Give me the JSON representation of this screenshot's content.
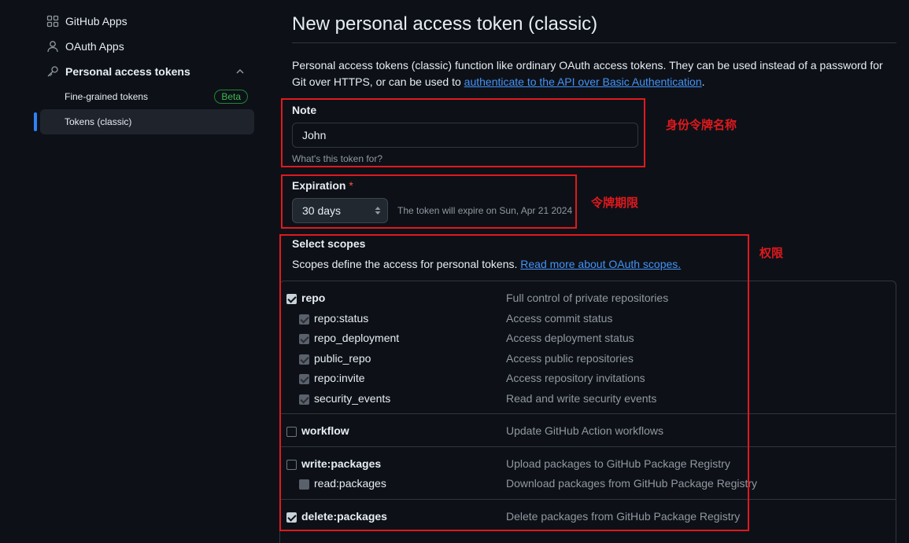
{
  "sidebar": {
    "items": [
      {
        "label": "GitHub Apps",
        "icon": "grid-icon"
      },
      {
        "label": "OAuth Apps",
        "icon": "person-icon"
      },
      {
        "label": "Personal access tokens",
        "icon": "key-icon"
      }
    ],
    "sub_items": [
      {
        "label": "Fine-grained tokens",
        "badge": "Beta"
      },
      {
        "label": "Tokens (classic)"
      }
    ]
  },
  "main": {
    "title": "New personal access token (classic)",
    "intro_text": "Personal access tokens (classic) function like ordinary OAuth access tokens. They can be used instead of a password for Git over HTTPS, or can be used to ",
    "intro_link": "authenticate to the API over Basic Authentication",
    "intro_end": ".",
    "note": {
      "label": "Note",
      "value": "John",
      "hint": "What's this token for?"
    },
    "expiration": {
      "label": "Expiration",
      "required_mark": "*",
      "selected": "30 days",
      "note": "The token will expire on Sun, Apr 21 2024"
    },
    "scopes": {
      "label": "Select scopes",
      "desc": "Scopes define the access for personal tokens. ",
      "link": "Read more about OAuth scopes.",
      "rows": [
        {
          "name": "repo",
          "desc": "Full control of private repositories",
          "checked": true,
          "sub": false
        },
        {
          "name": "repo:status",
          "desc": "Access commit status",
          "checked": true,
          "sub": true
        },
        {
          "name": "repo_deployment",
          "desc": "Access deployment status",
          "checked": true,
          "sub": true
        },
        {
          "name": "public_repo",
          "desc": "Access public repositories",
          "checked": true,
          "sub": true
        },
        {
          "name": "repo:invite",
          "desc": "Access repository invitations",
          "checked": true,
          "sub": true
        },
        {
          "name": "security_events",
          "desc": "Read and write security events",
          "checked": true,
          "sub": true
        },
        {
          "name": "workflow",
          "desc": "Update GitHub Action workflows",
          "checked": false,
          "sub": false
        },
        {
          "name": "write:packages",
          "desc": "Upload packages to GitHub Package Registry",
          "checked": false,
          "sub": false
        },
        {
          "name": "read:packages",
          "desc": "Download packages from GitHub Package Registry",
          "checked": false,
          "sub": true
        },
        {
          "name": "delete:packages",
          "desc": "Delete packages from GitHub Package Registry",
          "checked": true,
          "sub": false
        }
      ]
    }
  },
  "annotations": {
    "note_label": "身份令牌名称",
    "expiration_label": "令牌期限",
    "scopes_label": "权限",
    "color": "#e0191e"
  },
  "colors": {
    "background": "#0d1117",
    "link": "#4493f8",
    "selected_bar": "#2f81f7",
    "beta": "#3fb950"
  }
}
